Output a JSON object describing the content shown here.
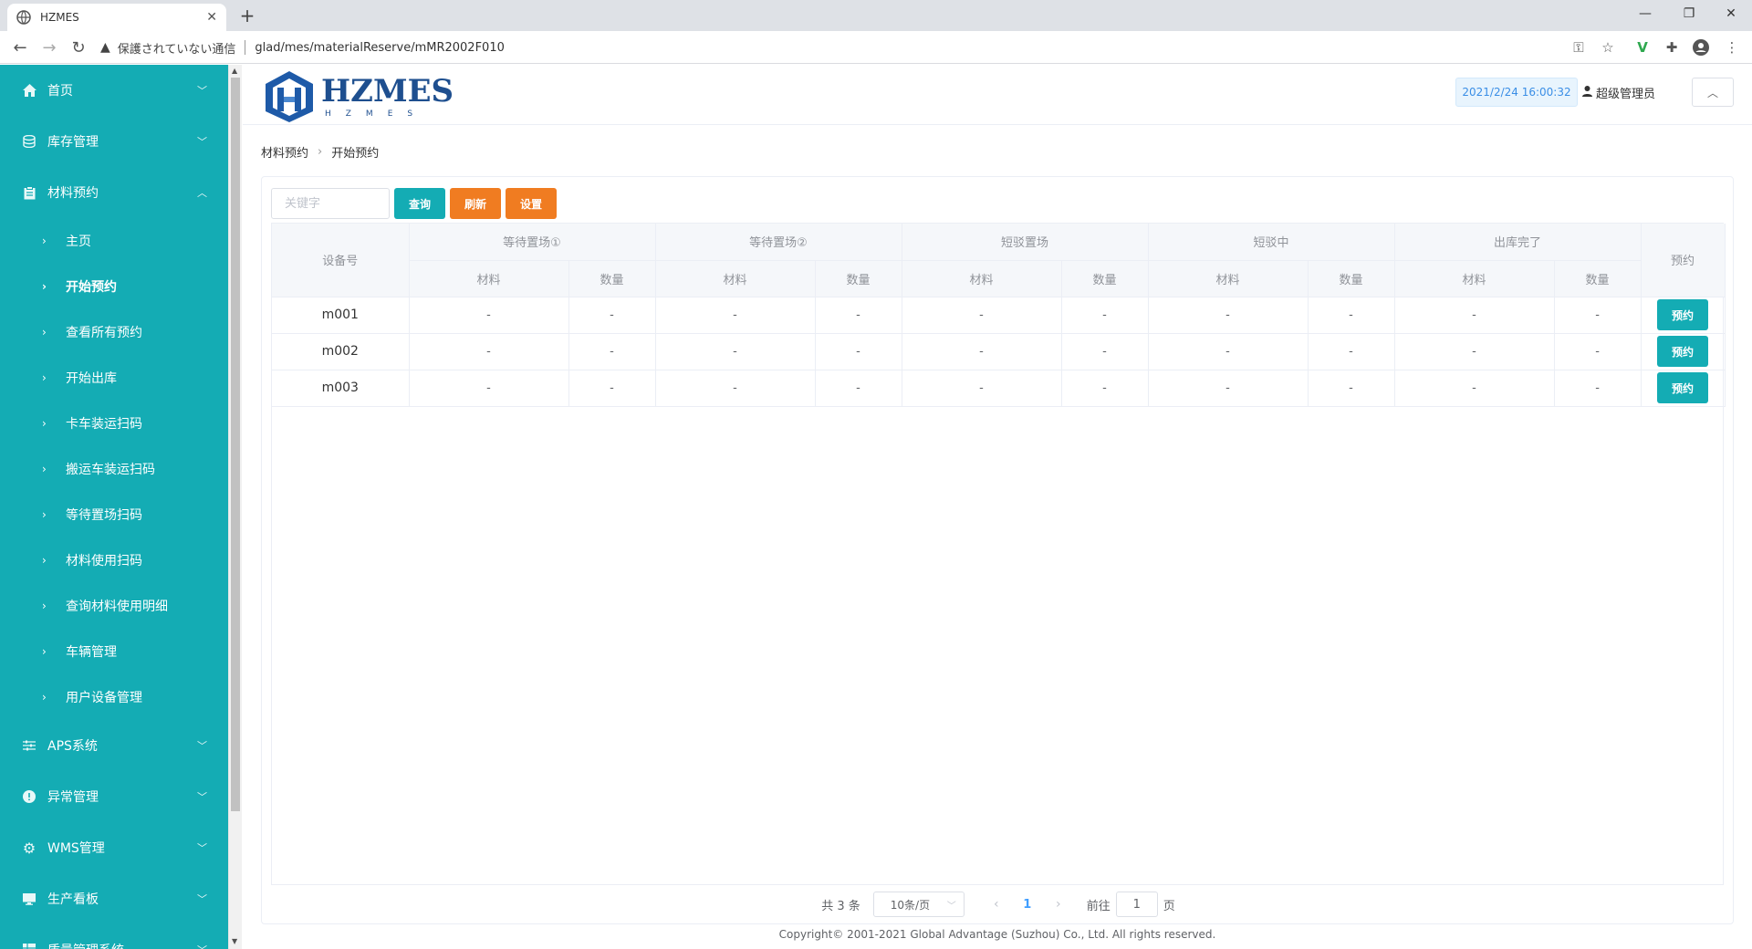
{
  "browser": {
    "tab_title": "HZMES",
    "insecure_label": "保護されていない通信",
    "url": "glad/mes/materialReserve/mMR2002F010"
  },
  "sidebar": {
    "menus": [
      {
        "label": "首页",
        "icon": "home-icon"
      },
      {
        "label": "库存管理",
        "icon": "database-icon"
      },
      {
        "label": "材料预约",
        "icon": "clipboard-icon"
      }
    ],
    "submenu": [
      {
        "label": "主页"
      },
      {
        "label": "开始预约"
      },
      {
        "label": "查看所有预约"
      },
      {
        "label": "开始出库"
      },
      {
        "label": "卡车装运扫码"
      },
      {
        "label": "搬运车装运扫码"
      },
      {
        "label": "等待置场扫码"
      },
      {
        "label": "材料使用扫码"
      },
      {
        "label": "查询材料使用明细"
      },
      {
        "label": "车辆管理"
      },
      {
        "label": "用户设备管理"
      }
    ],
    "menus_bottom": [
      {
        "label": "APS系统",
        "icon": "sliders-icon"
      },
      {
        "label": "异常管理",
        "icon": "alert-icon"
      },
      {
        "label": "WMS管理",
        "icon": "gear-icon"
      },
      {
        "label": "生产看板",
        "icon": "monitor-icon"
      },
      {
        "label": "质量管理系统",
        "icon": "grid-icon"
      }
    ]
  },
  "header": {
    "logo_text": "HZMES",
    "logo_sub": "HZMES",
    "datetime": "2021/2/24 16:00:32",
    "user": "超级管理员"
  },
  "breadcrumb": {
    "parent": "材料预约",
    "current": "开始预约"
  },
  "toolbar": {
    "keyword_placeholder": "关键字",
    "search_label": "查询",
    "refresh_label": "刷新",
    "settings_label": "设置"
  },
  "table": {
    "device_header": "设备号",
    "group_headers": [
      "等待置场①",
      "等待置场②",
      "短驳置场",
      "短驳中",
      "出库完了"
    ],
    "sub_material": "材料",
    "sub_quantity": "数量",
    "reserve_header": "预约",
    "rows": [
      {
        "device": "m001",
        "cells": [
          "-",
          "-",
          "-",
          "-",
          "-",
          "-",
          "-",
          "-",
          "-",
          "-"
        ],
        "action": "预约"
      },
      {
        "device": "m002",
        "cells": [
          "-",
          "-",
          "-",
          "-",
          "-",
          "-",
          "-",
          "-",
          "-",
          "-"
        ],
        "action": "预约"
      },
      {
        "device": "m003",
        "cells": [
          "-",
          "-",
          "-",
          "-",
          "-",
          "-",
          "-",
          "-",
          "-",
          "-"
        ],
        "action": "预约"
      }
    ]
  },
  "pager": {
    "total": "共 3 条",
    "page_size": "10条/页",
    "current_page": "1",
    "goto_label": "前往",
    "goto_value": "1",
    "page_unit": "页"
  },
  "footer": {
    "copyright": "Copyright© 2001-2021 Global Advantage (Suzhou) Co., Ltd. All rights reserved."
  },
  "colors": {
    "sidebar_bg": "#14acb4",
    "accent_teal": "#14acb4",
    "accent_orange": "#f07c21",
    "logo_blue": "#1e4f8f"
  }
}
